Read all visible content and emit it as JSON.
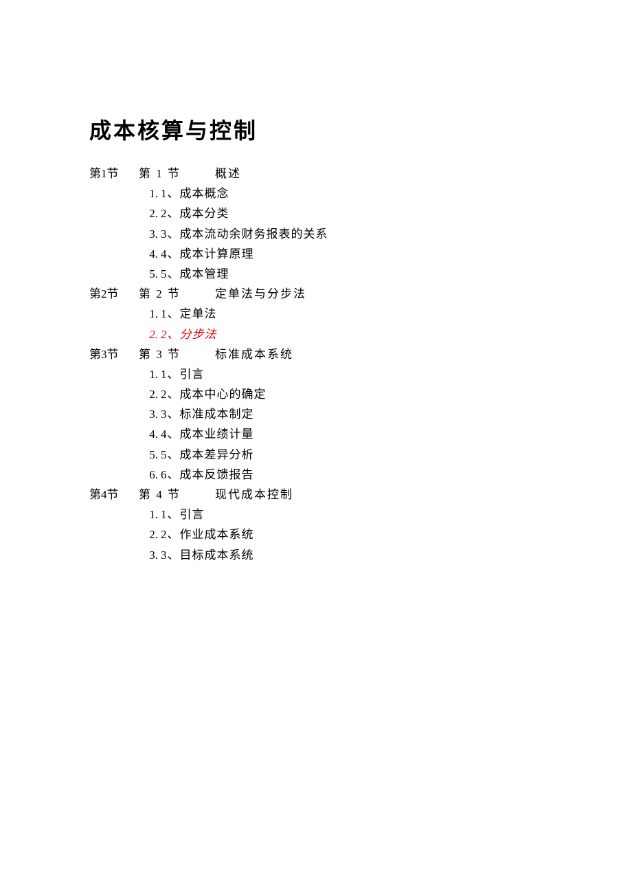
{
  "title": "成本核算与控制",
  "sections": [
    {
      "label": "第1节",
      "heading_num": "第 1 节",
      "heading_title": "概述",
      "items": [
        {
          "outer": "1.",
          "inner": "1、成本概念",
          "highlight": false
        },
        {
          "outer": "2.",
          "inner": "2、成本分类",
          "highlight": false
        },
        {
          "outer": "3.",
          "inner": "3、成本流动余财务报表的关系",
          "highlight": false
        },
        {
          "outer": "4.",
          "inner": "4、成本计算原理",
          "highlight": false
        },
        {
          "outer": "5.",
          "inner": "5、成本管理",
          "highlight": false
        }
      ]
    },
    {
      "label": "第2节",
      "heading_num": "第 2 节",
      "heading_title": "定单法与分步法",
      "items": [
        {
          "outer": "1.",
          "inner": "1、定单法",
          "highlight": false
        },
        {
          "outer": "2.",
          "inner": "2、分步法",
          "highlight": true
        }
      ]
    },
    {
      "label": "第3节",
      "heading_num": "第 3 节",
      "heading_title": "标准成本系统",
      "items": [
        {
          "outer": "1.",
          "inner": "1、引言",
          "highlight": false
        },
        {
          "outer": "2.",
          "inner": "2、成本中心的确定",
          "highlight": false
        },
        {
          "outer": "3.",
          "inner": "3、标准成本制定",
          "highlight": false
        },
        {
          "outer": "4.",
          "inner": "4、成本业绩计量",
          "highlight": false
        },
        {
          "outer": "5.",
          "inner": "5、成本差异分析",
          "highlight": false
        },
        {
          "outer": "6.",
          "inner": "6、成本反馈报告",
          "highlight": false
        }
      ]
    },
    {
      "label": "第4节",
      "heading_num": "第 4 节",
      "heading_title": "现代成本控制",
      "items": [
        {
          "outer": "1.",
          "inner": "1、引言",
          "highlight": false
        },
        {
          "outer": "2.",
          "inner": "2、作业成本系统",
          "highlight": false
        },
        {
          "outer": "3.",
          "inner": "3、目标成本系统",
          "highlight": false
        }
      ]
    }
  ]
}
